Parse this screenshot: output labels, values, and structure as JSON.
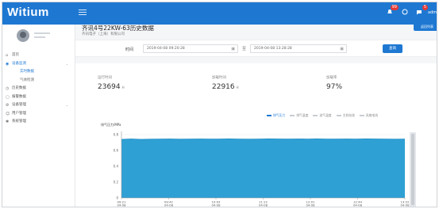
{
  "app": {
    "logo": "Witium",
    "notify_count": "99",
    "message_count": "5",
    "user_label": "admin",
    "pill_label": "返回列表"
  },
  "sidebar": {
    "items": [
      {
        "label": "首页",
        "icon": "home-icon"
      },
      {
        "label": "设备监测",
        "icon": "monitor-icon",
        "open": true
      },
      {
        "label": "实时数据",
        "sub": true,
        "active": true
      },
      {
        "label": "气体检测",
        "sub": true
      },
      {
        "label": "历史数据",
        "icon": "history-icon"
      },
      {
        "label": "报警数据",
        "icon": "alarm-icon"
      },
      {
        "label": "设备管理",
        "icon": "device-icon"
      },
      {
        "label": "用户管理",
        "icon": "user-icon"
      },
      {
        "label": "系统管理",
        "icon": "settings-icon"
      }
    ]
  },
  "page": {
    "title": "齐讯4号22KW-63历史数据",
    "subtitle": "齐讯电子（上海）有限公司"
  },
  "filter": {
    "label": "时间",
    "start": "2019-04-08 09:20:28",
    "end": "2019-04-08 13:28:28",
    "separator": "至",
    "query_button": "查询"
  },
  "stats": [
    {
      "label": "运行时间",
      "value": "23694",
      "unit": "H"
    },
    {
      "label": "加载时间",
      "value": "22916",
      "unit": "H"
    },
    {
      "label": "加载率",
      "value": "97%",
      "unit": ""
    }
  ],
  "legend": [
    {
      "label": "排气压力",
      "on": true
    },
    {
      "label": "排气温度",
      "on": false
    },
    {
      "label": "油气温度",
      "on": false
    },
    {
      "label": "主机电流",
      "on": false
    },
    {
      "label": "风扇电流",
      "on": false
    }
  ],
  "colors": {
    "accent": "#1e78d2",
    "area_fill": "#2fa0d4",
    "area_line": "#1b8ac4"
  },
  "chart_data": {
    "type": "area",
    "ylabel": "排气压力/MPa",
    "ylim": [
      0,
      0.8
    ],
    "yticks": [
      "0",
      "0.2",
      "0.4",
      "0.6",
      "0.8"
    ],
    "xticks": [
      "09:21\n04-08",
      "09:42\n04-08",
      "10:03\n04-08",
      "11:12\n04-08",
      "12:01\n04-08",
      "12:44\n04-08",
      "13:22\n04-08"
    ],
    "series": [
      {
        "name": "排气压力",
        "values": [
          0.74,
          0.745,
          0.74,
          0.742,
          0.744,
          0.745,
          0.742,
          0.743,
          0.745,
          0.744,
          0.743,
          0.746,
          0.744,
          0.742,
          0.744,
          0.746,
          0.745,
          0.743,
          0.745,
          0.744,
          0.746,
          0.744,
          0.743,
          0.745,
          0.744,
          0.746,
          0.745,
          0.744,
          0.742,
          0.744
        ]
      }
    ]
  }
}
